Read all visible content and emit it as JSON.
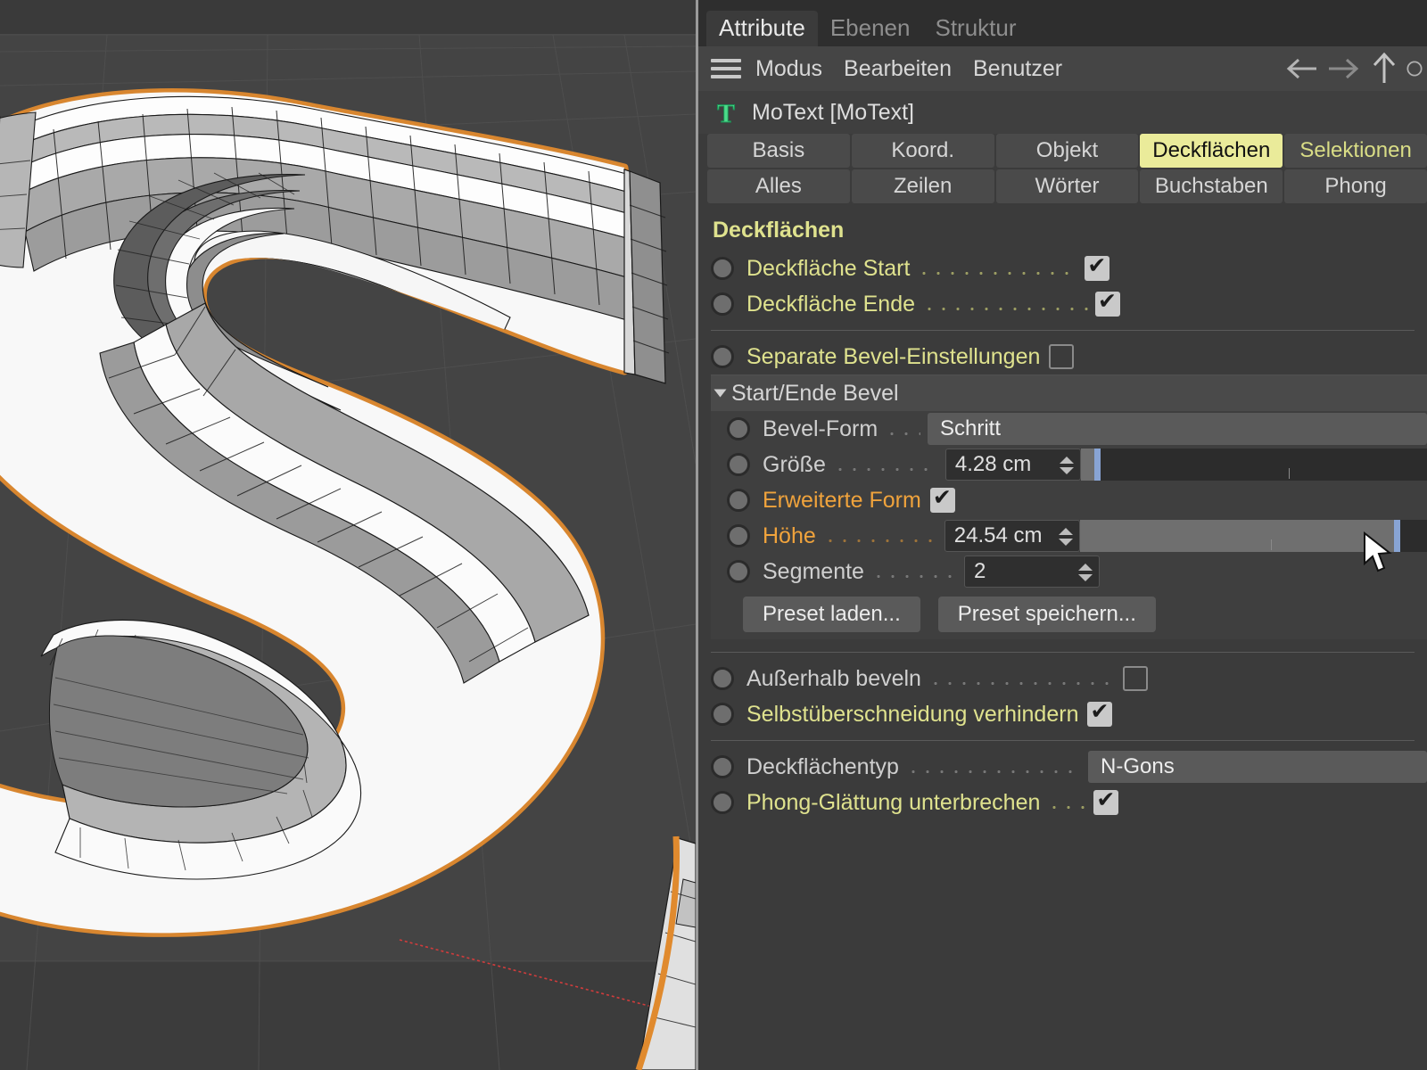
{
  "window_tabs": [
    {
      "label": "Attribute",
      "active": true
    },
    {
      "label": "Ebenen",
      "active": false
    },
    {
      "label": "Struktur",
      "active": false
    }
  ],
  "menu": {
    "hamburger_icon": "hamburger-icon",
    "items": [
      "Modus",
      "Bearbeiten",
      "Benutzer"
    ],
    "nav_icons": [
      "arrow-left-icon",
      "arrow-right-icon",
      "arrow-up-icon",
      "circle-icon"
    ]
  },
  "object": {
    "icon": "motext-T-icon",
    "icon_color": "#4bdc8a",
    "name": "MoText [MoText]"
  },
  "attribute_tabs": {
    "row1": [
      {
        "label": "Basis",
        "active": false,
        "highlight": false
      },
      {
        "label": "Koord.",
        "active": false,
        "highlight": false
      },
      {
        "label": "Objekt",
        "active": false,
        "highlight": false
      },
      {
        "label": "Deckflächen",
        "active": true,
        "highlight": false
      },
      {
        "label": "Selektionen",
        "active": false,
        "highlight": true
      }
    ],
    "row2": [
      {
        "label": "Alles",
        "active": false,
        "highlight": false
      },
      {
        "label": "Zeilen",
        "active": false,
        "highlight": false
      },
      {
        "label": "Wörter",
        "active": false,
        "highlight": false
      },
      {
        "label": "Buchstaben",
        "active": false,
        "highlight": false
      },
      {
        "label": "Phong",
        "active": false,
        "highlight": false
      }
    ]
  },
  "section": {
    "title": "Deckflächen",
    "rows": [
      {
        "label": "Deckfläche Start",
        "type": "checkbox",
        "checked": true,
        "color": "yellow"
      },
      {
        "label": "Deckfläche Ende",
        "type": "checkbox",
        "checked": true,
        "color": "yellow"
      },
      {
        "label": "Separate Bevel-Einstellungen",
        "type": "checkbox",
        "checked": false,
        "color": "yellow"
      }
    ]
  },
  "bevel_group": {
    "title": "Start/Ende Bevel",
    "expanded": true,
    "bevel_form": {
      "label": "Bevel-Form",
      "value": "Schritt",
      "color": "grey"
    },
    "groesse": {
      "label": "Größe",
      "value": "4.28 cm",
      "color": "grey",
      "slider_pct": 4,
      "knob_pct": 4
    },
    "erweiterte_form": {
      "label": "Erweiterte Form",
      "checked": true,
      "color": "orange"
    },
    "hoehe": {
      "label": "Höhe",
      "value": "24.54 cm",
      "color": "orange",
      "slider_pct": 91,
      "knob_pct": 91
    },
    "segmente": {
      "label": "Segmente",
      "value": "2",
      "color": "grey"
    },
    "buttons": [
      {
        "label": "Preset laden..."
      },
      {
        "label": "Preset speichern..."
      }
    ]
  },
  "bottom_rows": [
    {
      "label": "Außerhalb beveln",
      "type": "checkbox",
      "checked": false,
      "color": "grey"
    },
    {
      "label": "Selbstüberschneidung verhindern",
      "type": "checkbox",
      "checked": true,
      "color": "yellow"
    }
  ],
  "final_rows": {
    "deckflaechentyp": {
      "label": "Deckflächentyp",
      "value": "N-Gons",
      "color": "grey"
    },
    "phong": {
      "label": "Phong-Glättung unterbrechen",
      "checked": true,
      "color": "yellow"
    }
  },
  "viewport": {
    "object_label": "letter-S-3d-mesh",
    "selection_outline_color": "#e08a2e",
    "front_face_color": "#f7f7f7",
    "background_color": "#444444",
    "axis_color": "#d04040",
    "cursor": "mouse-pointer"
  },
  "colors": {
    "panel_bg": "#3b3b3b",
    "accent_yellow": "#dfe28e",
    "accent_orange": "#f0a33c",
    "slider_blue": "#88a4d4",
    "tab_active_bg": "#eaeb9a"
  }
}
